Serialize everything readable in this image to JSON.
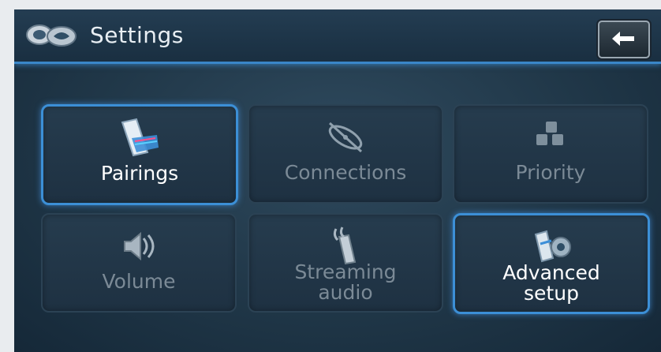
{
  "header": {
    "title": "Settings",
    "back_icon": "back-arrow-icon",
    "accent_color": "#3c8fd6"
  },
  "tiles": [
    {
      "label": "Pairings",
      "icon": "phone-pairing-icon",
      "state": "active"
    },
    {
      "label": "Connections",
      "icon": "connection-orbit-icon",
      "state": "disabled"
    },
    {
      "label": "Priority",
      "icon": "priority-blocks-icon",
      "state": "disabled"
    },
    {
      "label": "Volume",
      "icon": "speaker-volume-icon",
      "state": "disabled"
    },
    {
      "label_line1": "Streaming",
      "label_line2": "audio",
      "icon": "streaming-phone-icon",
      "state": "disabled"
    },
    {
      "label_line1": "Advanced",
      "label_line2": "setup",
      "icon": "advanced-setup-icon",
      "state": "active"
    }
  ]
}
